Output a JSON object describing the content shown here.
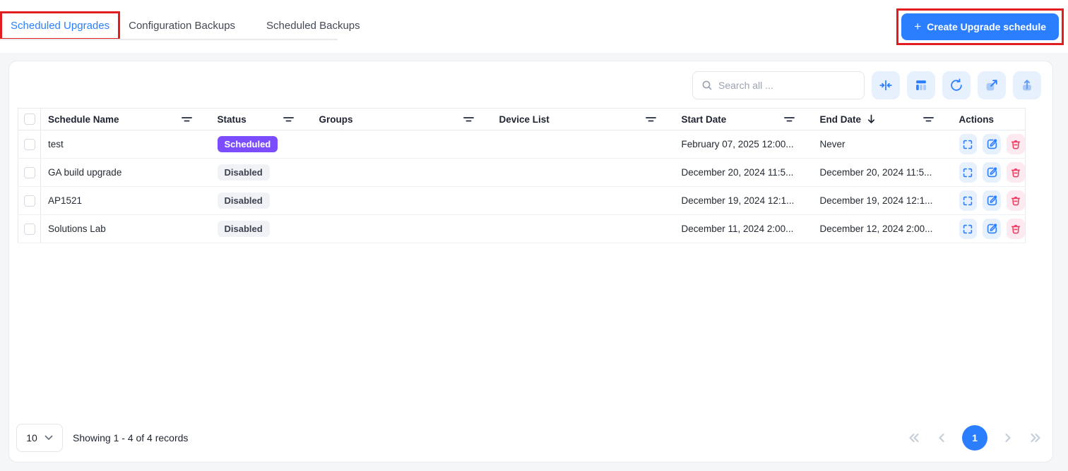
{
  "tabs": [
    {
      "label": "Scheduled Upgrades",
      "active": true
    },
    {
      "label": "Configuration Backups",
      "active": false
    },
    {
      "label": "Scheduled Backups",
      "active": false
    }
  ],
  "header": {
    "create_button_label": "Create Upgrade schedule",
    "plus": "+"
  },
  "toolbar": {
    "search_placeholder": "Search all ...",
    "buttons": [
      "collapse-columns",
      "manage-columns",
      "refresh",
      "open-expanded",
      "export"
    ]
  },
  "table": {
    "columns": [
      "Schedule Name",
      "Status",
      "Groups",
      "Device List",
      "Start Date",
      "End Date",
      "Actions"
    ],
    "sorted_column": "End Date",
    "sort_direction": "desc",
    "rows": [
      {
        "name": "test",
        "status": "Scheduled",
        "groups": "",
        "device_list": "",
        "start": "February 07, 2025 12:00...",
        "end": "Never"
      },
      {
        "name": "GA build upgrade",
        "status": "Disabled",
        "groups": "",
        "device_list": "",
        "start": "December 20, 2024 11:5...",
        "end": "December 20, 2024 11:5..."
      },
      {
        "name": "AP1521",
        "status": "Disabled",
        "groups": "",
        "device_list": "",
        "start": "December 19, 2024 12:1...",
        "end": "December 19, 2024 12:1..."
      },
      {
        "name": "Solutions Lab",
        "status": "Disabled",
        "groups": "",
        "device_list": "",
        "start": "December 11, 2024 2:00...",
        "end": "December 12, 2024 2:00..."
      }
    ]
  },
  "pagination": {
    "page_size": "10",
    "summary": "Showing 1 - 4 of 4 records",
    "page": "1"
  },
  "colors": {
    "accent_blue": "#2b7fff",
    "badge_purple": "#7c4dff",
    "annotation_red": "#e21d1f",
    "danger_red": "#f23a5e",
    "icon_btn_bg": "#e7f0fd",
    "page_bg": "#f5f6f8"
  }
}
